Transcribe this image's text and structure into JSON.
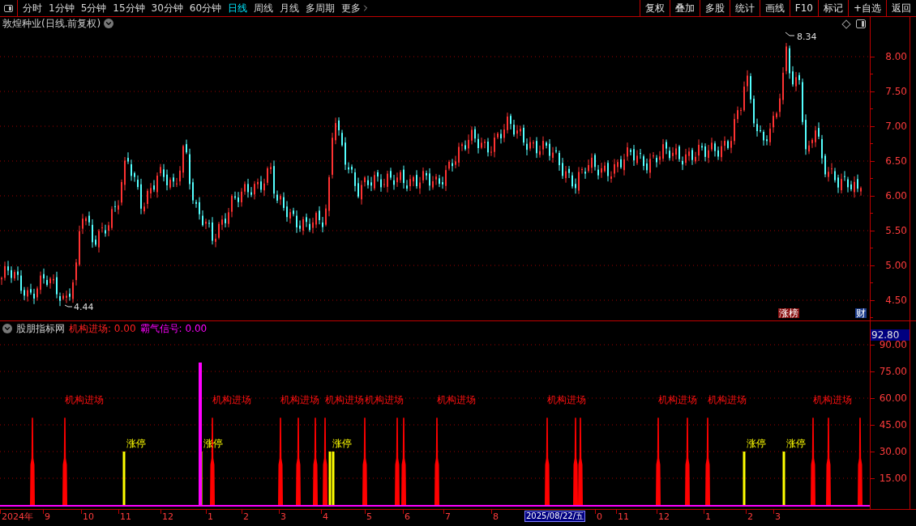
{
  "toolbar": {
    "periods": [
      {
        "label": "分时",
        "selected": false
      },
      {
        "label": "1分钟",
        "selected": false
      },
      {
        "label": "5分钟",
        "selected": false
      },
      {
        "label": "15分钟",
        "selected": false
      },
      {
        "label": "30分钟",
        "selected": false
      },
      {
        "label": "60分钟",
        "selected": false
      },
      {
        "label": "日线",
        "selected": true
      },
      {
        "label": "周线",
        "selected": false
      },
      {
        "label": "月线",
        "selected": false
      },
      {
        "label": "多周期",
        "selected": false
      }
    ],
    "more": "更多",
    "buttons": [
      "复权",
      "叠加",
      "多股",
      "统计",
      "画线",
      "F10",
      "标记",
      "+自选",
      "返回"
    ]
  },
  "chart": {
    "title": "敦煌种业(日线.前复权)",
    "high_label": "8.34",
    "low_label": "4.44",
    "y_axis": [
      "8.00",
      "7.50",
      "7.00",
      "6.50",
      "6.00",
      "5.50",
      "5.00",
      "4.50"
    ],
    "badges": [
      {
        "kind": "rank",
        "label": "涨榜"
      },
      {
        "kind": "finance",
        "label": "财"
      }
    ]
  },
  "indicator": {
    "name": "股朋指标网",
    "readouts": [
      {
        "label": "机构进场: 0.00",
        "color": "#ff2020"
      },
      {
        "label": "霸气信号: 0.00",
        "color": "#ff00ff"
      }
    ],
    "current_value": "92.80",
    "y_axis": [
      "90.00",
      "75.00",
      "60.00",
      "45.00",
      "30.00",
      "15.00"
    ],
    "signals": [
      {
        "kind": "entry"
      },
      {
        "kind": "entry",
        "label": "机构进场"
      },
      {
        "kind": "limit_up",
        "label": "涨停"
      },
      {
        "kind": "limit_up",
        "label": "涨停"
      },
      {
        "kind": "momentum"
      },
      {
        "kind": "entry",
        "label": "机构进场"
      },
      {
        "kind": "entry",
        "label": "机构进场"
      },
      {
        "kind": "entry"
      },
      {
        "kind": "entry"
      },
      {
        "kind": "entry",
        "label": "机构进场"
      },
      {
        "kind": "limit_up",
        "label": "涨停"
      },
      {
        "kind": "limit_up"
      },
      {
        "kind": "entry",
        "label": "机构进场"
      },
      {
        "kind": "entry"
      },
      {
        "kind": "entry"
      },
      {
        "kind": "entry",
        "label": "机构进场"
      },
      {
        "kind": "entry",
        "label": "机构进场"
      },
      {
        "kind": "entry"
      },
      {
        "kind": "entry"
      },
      {
        "kind": "entry",
        "label": "机构进场"
      },
      {
        "kind": "entry"
      },
      {
        "kind": "entry",
        "label": "机构进场"
      },
      {
        "kind": "limit_up",
        "label": "涨停"
      },
      {
        "kind": "limit_up",
        "label": "涨停"
      },
      {
        "kind": "entry",
        "label": "机构进场"
      },
      {
        "kind": "entry"
      },
      {
        "kind": "entry"
      }
    ]
  },
  "time_axis": {
    "labels": [
      "2024年",
      "9",
      "10",
      "11",
      "12",
      "1",
      "2",
      "3",
      "4",
      "5",
      "6",
      "7",
      "8",
      "0",
      "11",
      "12",
      "1",
      "2",
      "3"
    ],
    "cursor_date": "2025/08/22/五"
  }
}
